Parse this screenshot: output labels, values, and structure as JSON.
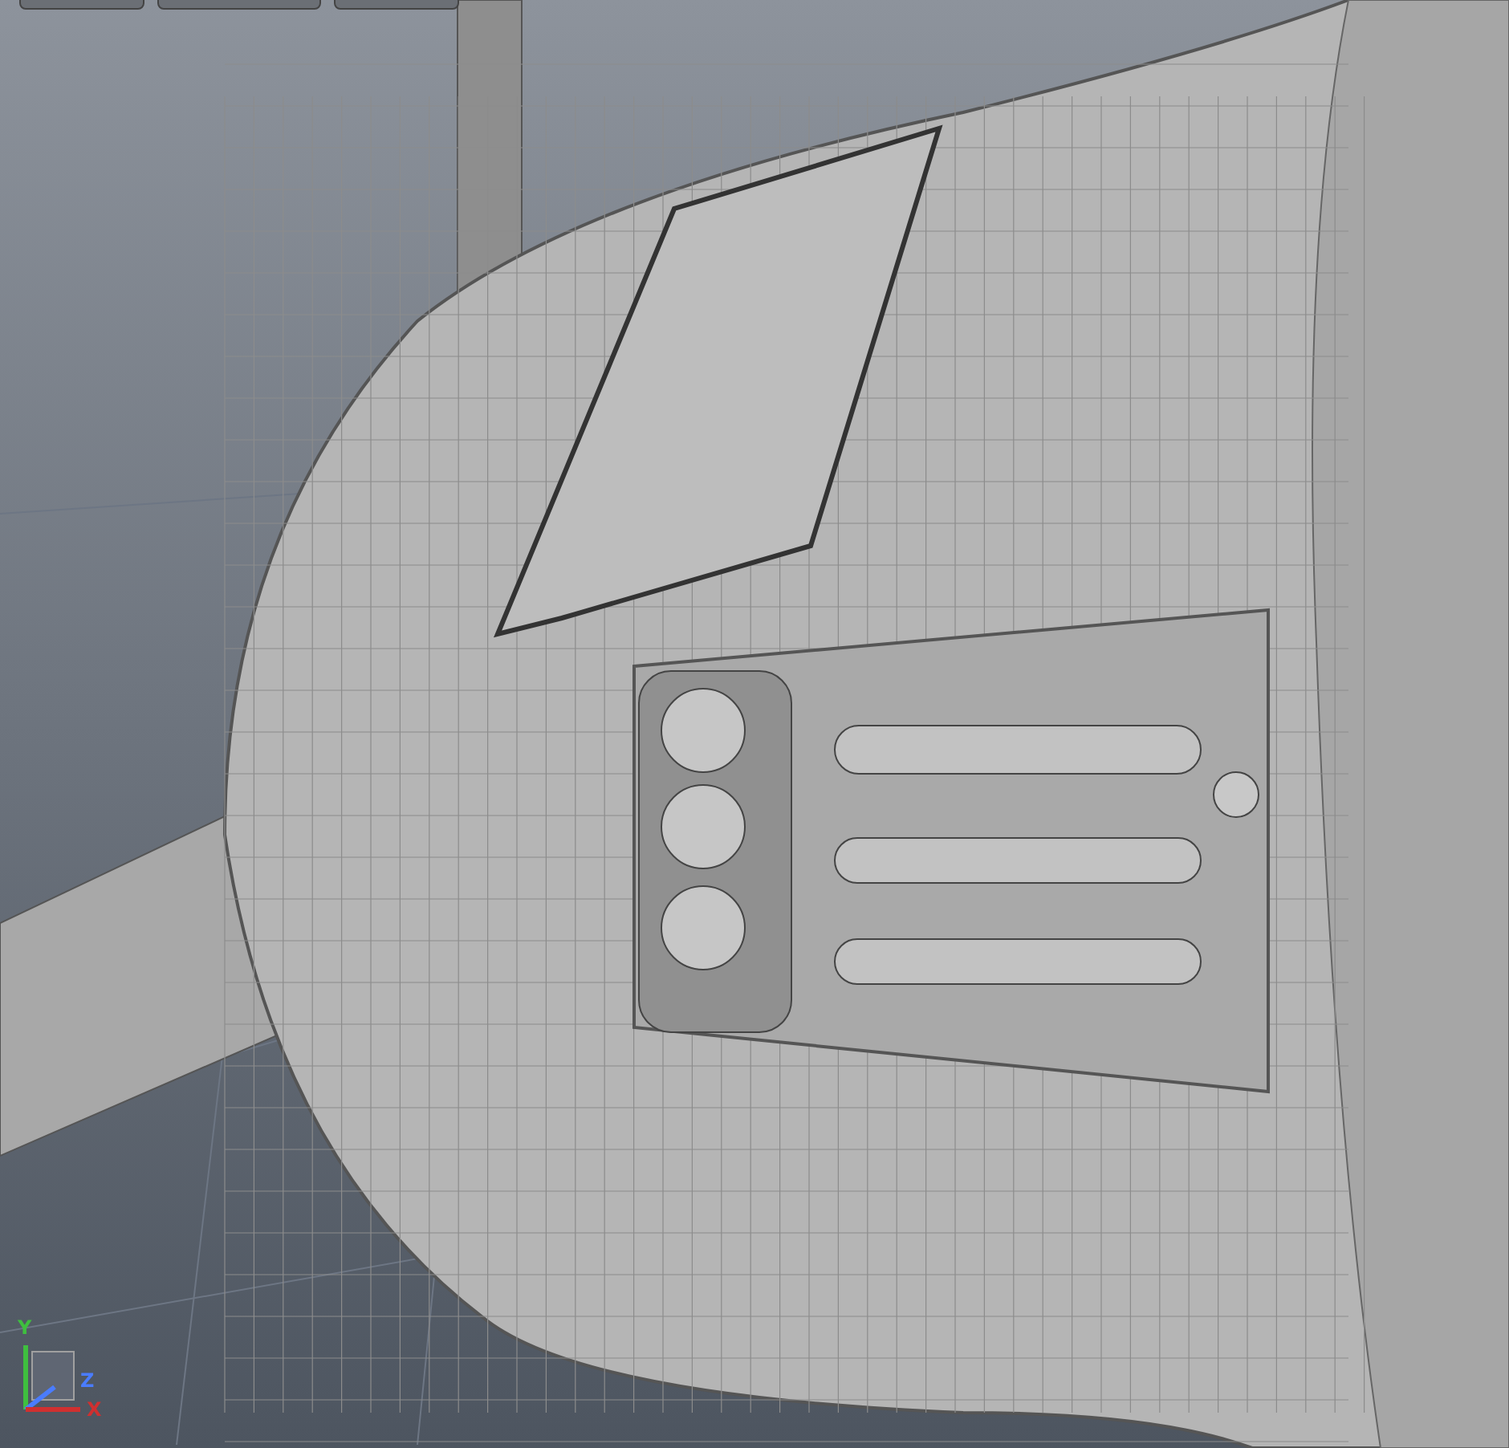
{
  "viewport": {
    "axes": [
      {
        "label": "Y",
        "color": "#3fbf3f"
      },
      {
        "label": "Z",
        "color": "#4a7cff"
      },
      {
        "label": "X",
        "color": "#d03030"
      }
    ]
  }
}
